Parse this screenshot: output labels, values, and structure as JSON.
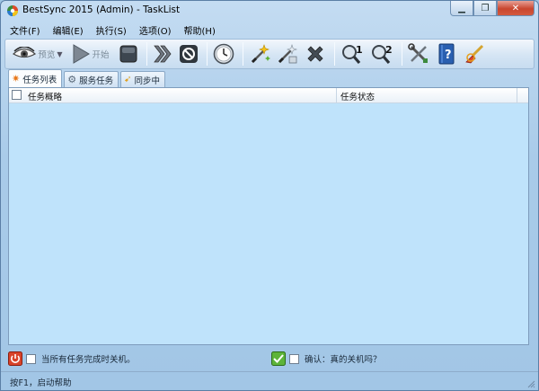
{
  "window": {
    "title": "BestSync 2015 (Admin) - TaskList"
  },
  "menu": [
    {
      "label": "文件(F)"
    },
    {
      "label": "编辑(E)"
    },
    {
      "label": "执行(S)"
    },
    {
      "label": "选项(O)"
    },
    {
      "label": "帮助(H)"
    }
  ],
  "toolbar": {
    "preview_label": "预览",
    "start_label": "开始",
    "icons": [
      "eye-icon",
      "play-icon",
      "stop-icon",
      "fast-forward-icon",
      "cancel-icon",
      "clock-icon",
      "new-task-wand-icon",
      "edit-wand-icon",
      "delete-x-icon",
      "search-1-icon",
      "search-2-icon",
      "tools-icon",
      "help-book-icon",
      "clean-brush-icon"
    ]
  },
  "tabs": [
    {
      "label": "任务列表",
      "icon": "star-icon",
      "active": true
    },
    {
      "label": "服务任务",
      "icon": "gear-icon",
      "active": false
    },
    {
      "label": "同步中",
      "icon": "sync-arrow-icon",
      "active": false
    }
  ],
  "list": {
    "columns": [
      "任务概略",
      "任务状态"
    ],
    "rows": []
  },
  "bottom": {
    "shutdown_label": "当所有任务完成时关机。",
    "confirm_label": "确认：真的关机吗？"
  },
  "status": {
    "text": "按F1，启动帮助"
  },
  "colors": {
    "list_bg": "#bfe3fb",
    "close_btn": "#c9462f",
    "accent": "#2a6fc0"
  }
}
